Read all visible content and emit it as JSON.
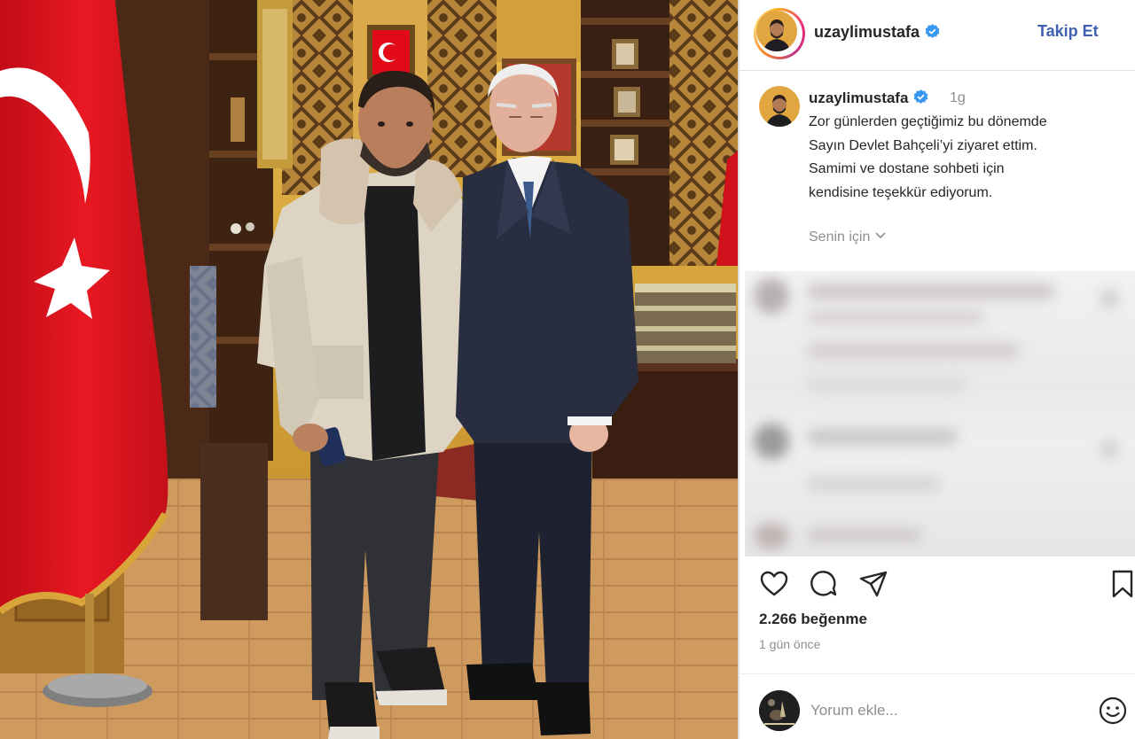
{
  "header": {
    "username": "uzaylimustafa",
    "follow_label": "Takip Et",
    "verified_icon": "verified-badge-icon"
  },
  "caption": {
    "username": "uzaylimustafa",
    "time": "1g",
    "lines": [
      "Zor günlerden geçtiğimiz bu dönemde",
      "Sayın Devlet Bahçeli’yi ziyaret ettim.",
      "Samimi ve dostane sohbeti için",
      "kendisine teşekkür ediyorum."
    ],
    "for_you_label": "Senin için"
  },
  "actions": {
    "like_icon": "heart-icon",
    "comment_icon": "comment-icon",
    "share_icon": "share-icon",
    "save_icon": "bookmark-icon"
  },
  "stats": {
    "likes": "2.266 beğenme",
    "posted_ago": "1 gün önce"
  },
  "comment_box": {
    "placeholder": "Yorum ekle...",
    "emoji_icon": "emoji-icon"
  },
  "colors": {
    "follow_blue": "#3f5fb0",
    "verified_blue": "#3897f0",
    "muted_text": "#8e8e8e",
    "flag_red": "#e30a17"
  }
}
